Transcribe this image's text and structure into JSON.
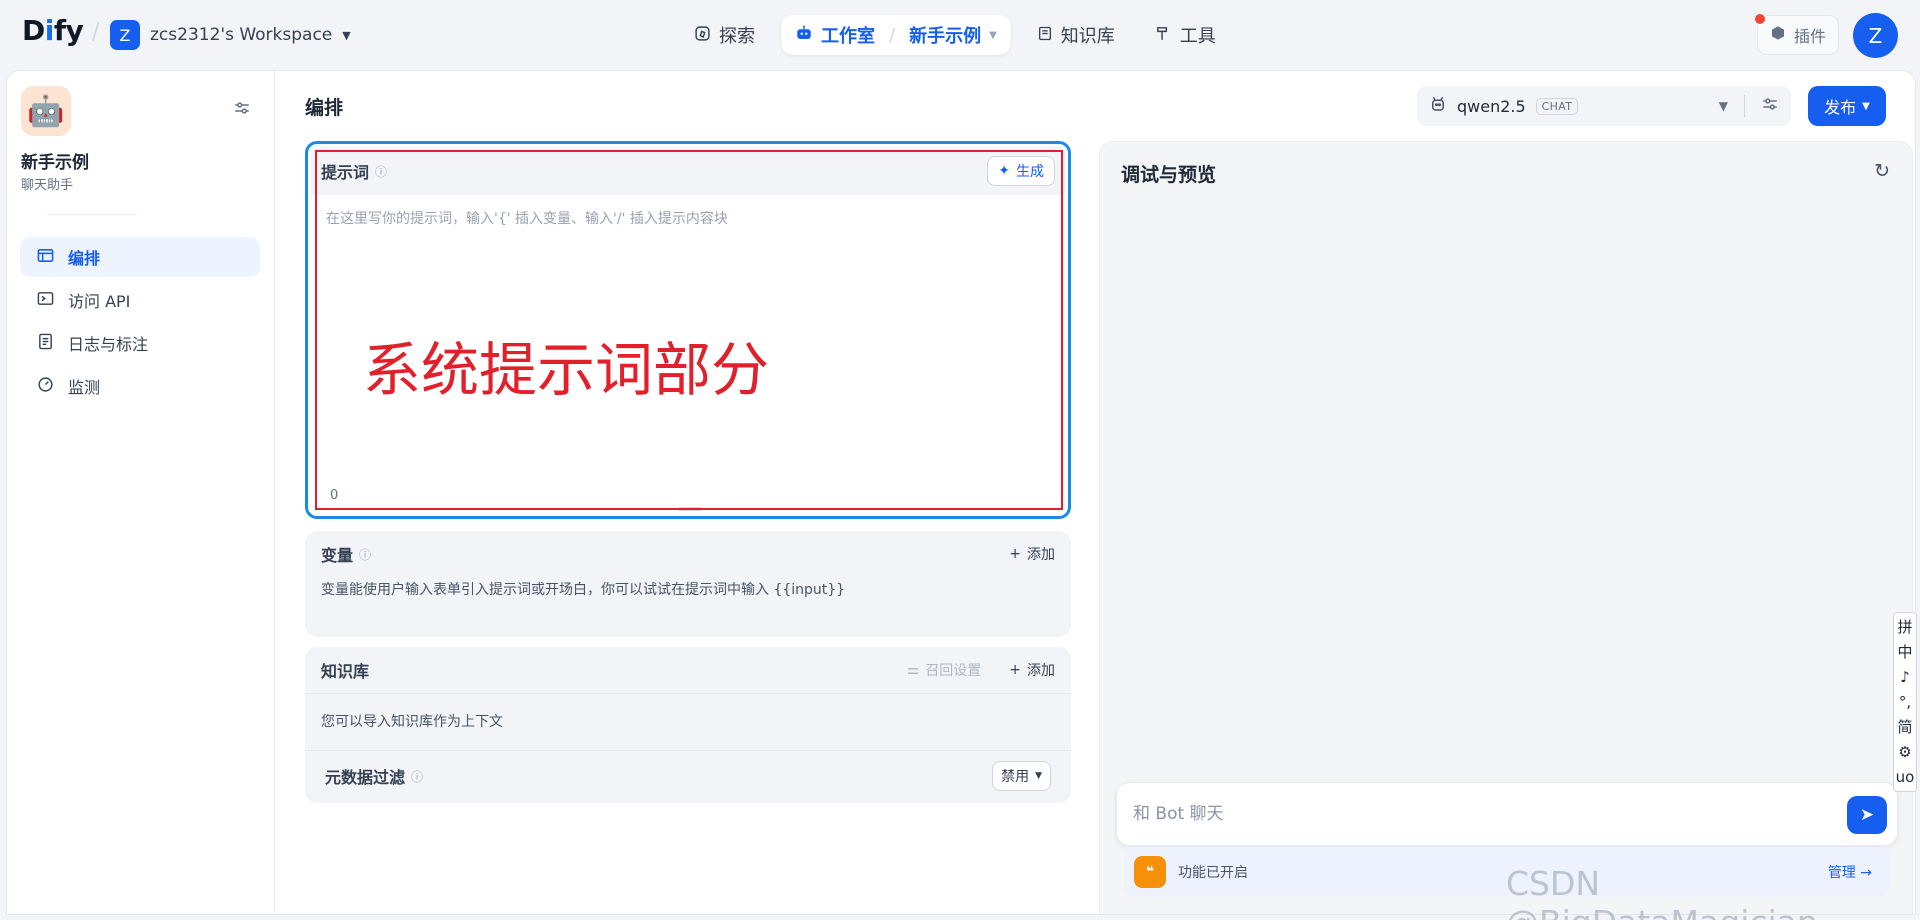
{
  "topbar": {
    "logo": "Dify",
    "workspace": {
      "initial": "Z",
      "name": "zcs2312's Workspace"
    },
    "nav": [
      {
        "label": "探索",
        "icon": "compass-icon"
      },
      {
        "label": "工作室",
        "icon": "robot-icon",
        "sub": "新手示例"
      },
      {
        "label": "知识库",
        "icon": "book-icon"
      },
      {
        "label": "工具",
        "icon": "hammer-icon"
      }
    ],
    "plugins_label": "插件",
    "user_initial": "Z"
  },
  "sidebar": {
    "app_name": "新手示例",
    "app_type": "聊天助手",
    "items": [
      {
        "label": "编排",
        "icon": "layout-icon",
        "active": true
      },
      {
        "label": "访问 API",
        "icon": "terminal-icon"
      },
      {
        "label": "日志与标注",
        "icon": "log-icon"
      },
      {
        "label": "监测",
        "icon": "gauge-icon"
      }
    ]
  },
  "orchestrate": {
    "title": "编排",
    "model": {
      "name": "qwen2.5",
      "badge": "CHAT"
    },
    "publish_label": "发布"
  },
  "prompt": {
    "title": "提示词",
    "generate_label": "生成",
    "placeholder": "在这里写你的提示词，输入'{' 插入变量、输入'/' 插入提示内容块",
    "annotation": "系统提示词部分",
    "char_count": "0"
  },
  "variables": {
    "title": "变量",
    "add_label": "添加",
    "description": "变量能使用户输入表单引入提示词或开场白，你可以试试在提示词中输入 {{input}}"
  },
  "knowledge": {
    "title": "知识库",
    "recall_label": "召回设置",
    "add_label": "添加",
    "description": "您可以导入知识库作为上下文",
    "metadata_filter_title": "元数据过滤",
    "metadata_filter_value": "禁用"
  },
  "debug": {
    "title": "调试与预览",
    "chat_placeholder": "和 Bot 聊天",
    "feature_status": "功能已开启",
    "manage_label": "管理 →"
  },
  "ime": [
    "拼",
    "中",
    "♪",
    "°,",
    "简",
    "⚙",
    "uo"
  ],
  "watermark": "CSDN @BigDataMagician",
  "colors": {
    "accent": "#155eef",
    "annotation_red": "#e0202a",
    "focus_border": "#1a8ae6"
  }
}
